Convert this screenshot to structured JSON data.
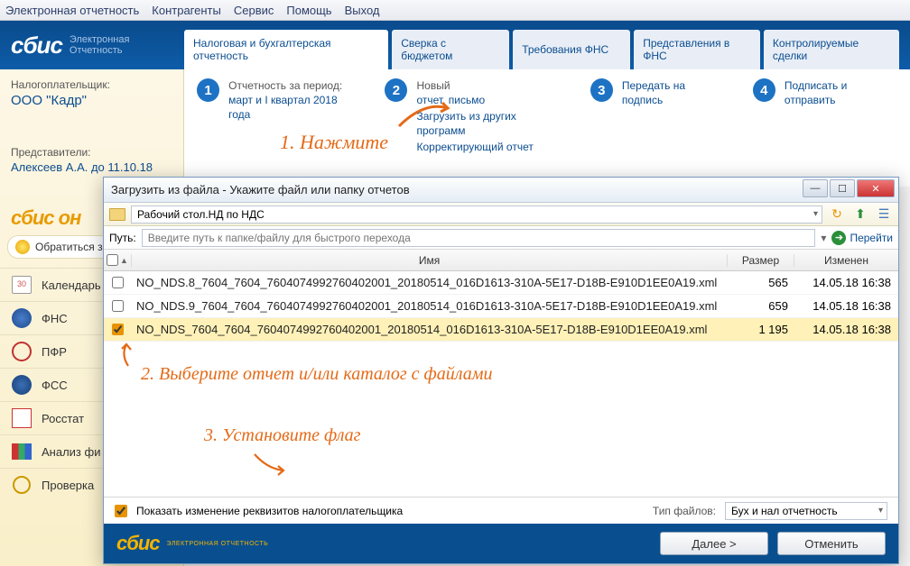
{
  "menu": [
    "Электронная отчетность",
    "Контрагенты",
    "Сервис",
    "Помощь",
    "Выход"
  ],
  "logo": {
    "main": "сбис",
    "sub1": "Электронная",
    "sub2": "Отчетность"
  },
  "tabs": [
    "Налоговая и бухгалтерская отчетность",
    "Сверка с бюджетом",
    "Требования ФНС",
    "Представления в ФНС",
    "Контролируемые сделки"
  ],
  "taxpayer": {
    "label": "Налогоплательщик:",
    "org": "ООО \"Кадр\""
  },
  "reps": {
    "label": "Представители:",
    "person": "Алексеев А.А. до 11.10.18"
  },
  "side_logo": "сбис он",
  "side_help": "Обратиться з",
  "side_items": [
    {
      "label": "Календарь налогопла",
      "icon": "cal",
      "iconText": "30"
    },
    {
      "label": "ФНС",
      "icon": "fns"
    },
    {
      "label": "ПФР",
      "icon": "pfr"
    },
    {
      "label": "ФСС",
      "icon": "fss"
    },
    {
      "label": "Росстат",
      "icon": "ros"
    },
    {
      "label": "Анализ фи и налогов",
      "icon": "ana"
    },
    {
      "label": "Проверка",
      "icon": "chk"
    }
  ],
  "steps": [
    {
      "num": "1",
      "title": "Отчетность за период:",
      "link": "март и I квартал 2018 года"
    },
    {
      "num": "2",
      "title": "Новый",
      "links": [
        "отчет, письмо",
        "Загрузить из других программ",
        "Корректирующий отчет"
      ]
    },
    {
      "num": "3",
      "title": "",
      "links": [
        "Передать на подпись"
      ]
    },
    {
      "num": "4",
      "title": "",
      "links": [
        "Подписать и отправить"
      ]
    }
  ],
  "annotations": {
    "a1": "1. Нажмите",
    "a2": "2. Выберите отчет и/или каталог с файлами",
    "a3": "3. Установите флаг"
  },
  "dialog": {
    "title": "Загрузить из файла - Укажите файл или папку отчетов",
    "breadcrumb": "Рабочий стол.НД по НДС",
    "path_label": "Путь:",
    "path_placeholder": "Введите путь к папке/файлу для быстрого перехода",
    "go": "Перейти",
    "columns": {
      "name": "Имя",
      "size": "Размер",
      "mod": "Изменен"
    },
    "rows": [
      {
        "checked": false,
        "name": "NO_NDS.8_7604_7604_7604074992760402001_20180514_016D1613-310A-5E17-D18B-E910D1EE0A19.xml",
        "size": "565",
        "mod": "14.05.18 16:38"
      },
      {
        "checked": false,
        "name": "NO_NDS.9_7604_7604_7604074992760402001_20180514_016D1613-310A-5E17-D18B-E910D1EE0A19.xml",
        "size": "659",
        "mod": "14.05.18 16:38"
      },
      {
        "checked": true,
        "name": "NO_NDS_7604_7604_7604074992760402001_20180514_016D1613-310A-5E17-D18B-E910D1EE0A19.xml",
        "size": "1 195",
        "mod": "14.05.18 16:38"
      }
    ],
    "show_changes": "Показать изменение реквизитов налогоплательщика",
    "filetype_label": "Тип файлов:",
    "filetype_value": "Бух и нал отчетность",
    "next": "Далее >",
    "cancel": "Отменить",
    "bottom_logo": "сбис",
    "bottom_sub": "ЭЛЕКТРОННАЯ ОТЧЕТНОСТЬ"
  }
}
